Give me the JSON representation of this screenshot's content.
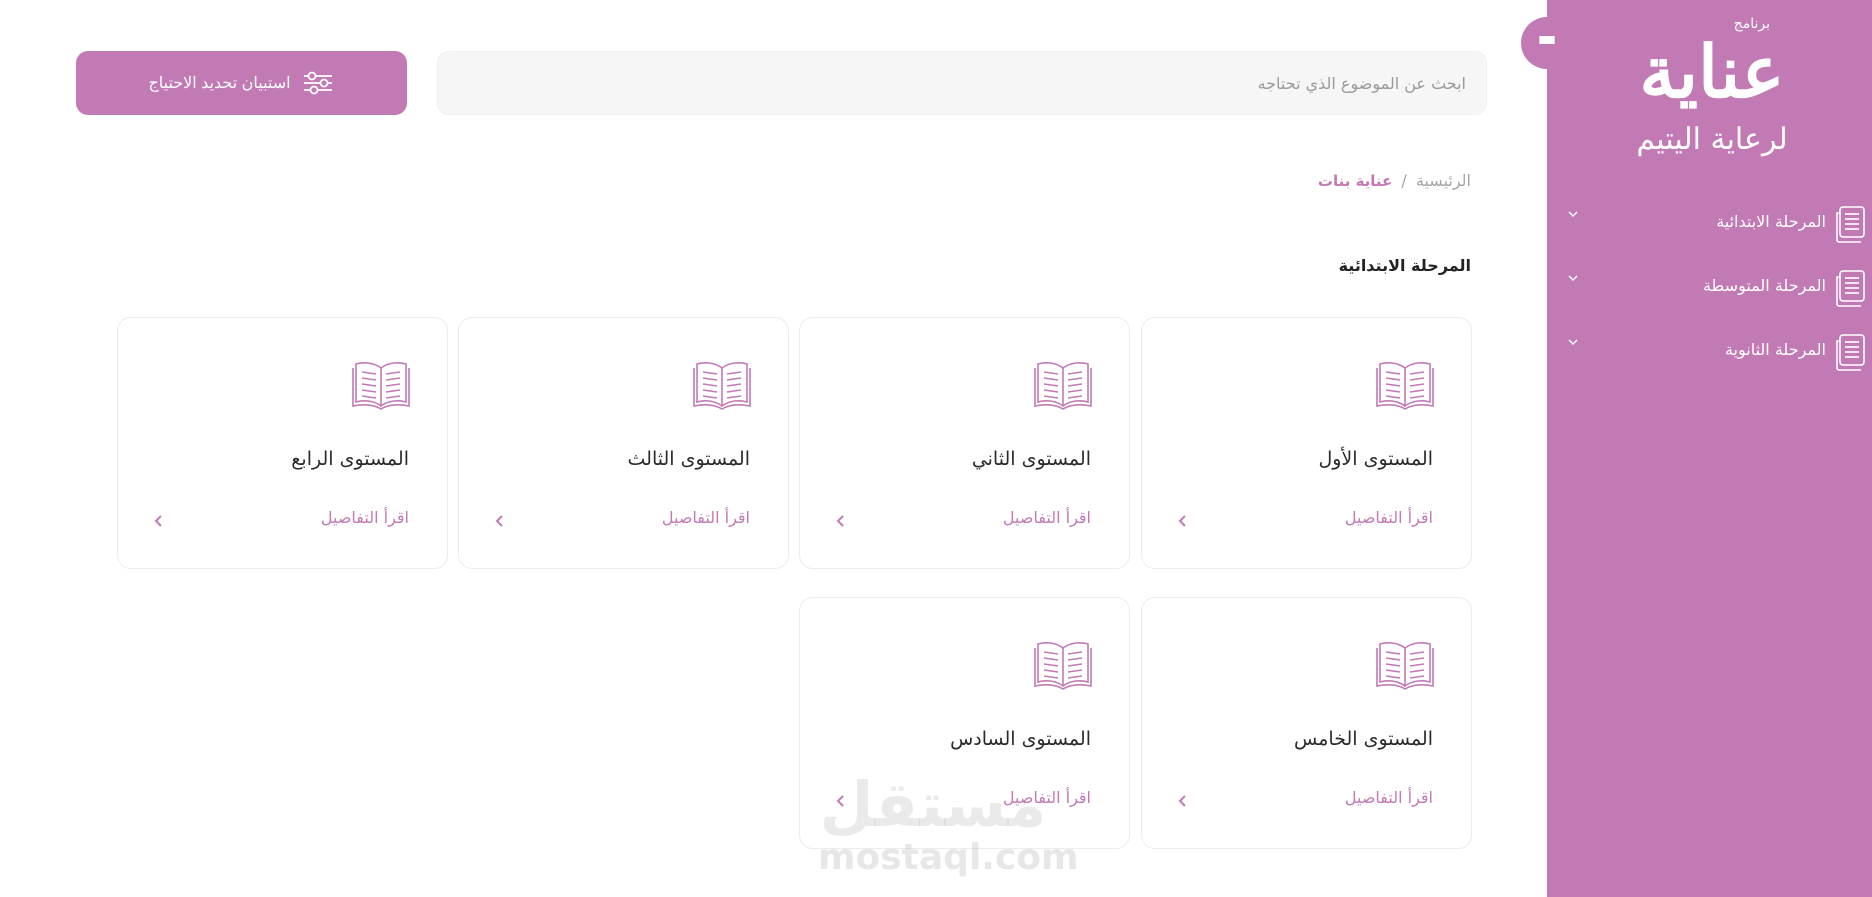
{
  "app": {
    "logo_top": "برنامج",
    "logo_main": "عناية",
    "logo_sub": "لرعاية اليتيم",
    "accent_color": "#c27ab5"
  },
  "sidebar": {
    "toggle_icon": "menu-icon",
    "items": [
      {
        "label": "المرحلة الابتدائية",
        "icon": "book-stack-icon"
      },
      {
        "label": "المرحلة المتوسطة",
        "icon": "book-stack-icon"
      },
      {
        "label": "المرحلة الثانوية",
        "icon": "book-stack-icon"
      }
    ]
  },
  "topbar": {
    "search_placeholder": "ابحث عن الموضوع الذي تحتاجه",
    "survey_button": "استبيان تحديد الاحتياج",
    "survey_icon": "sliders-icon"
  },
  "breadcrumb": {
    "home": "الرئيسية",
    "separator": "/",
    "current": "عناية بنات"
  },
  "section": {
    "title": "المرحلة الابتدائية"
  },
  "cards": [
    {
      "title": "المستوى الأول",
      "link": "اقرأ التفاصيل"
    },
    {
      "title": "المستوى الثاني",
      "link": "اقرأ التفاصيل"
    },
    {
      "title": "المستوى الثالث",
      "link": "اقرأ التفاصيل"
    },
    {
      "title": "المستوى الرابع",
      "link": "اقرأ التفاصيل"
    },
    {
      "title": "المستوى الخامس",
      "link": "اقرأ التفاصيل"
    },
    {
      "title": "المستوى السادس",
      "link": "اقرأ التفاصيل"
    }
  ],
  "watermark": {
    "arabic": "مستقل",
    "latin": "mostaql.com"
  }
}
